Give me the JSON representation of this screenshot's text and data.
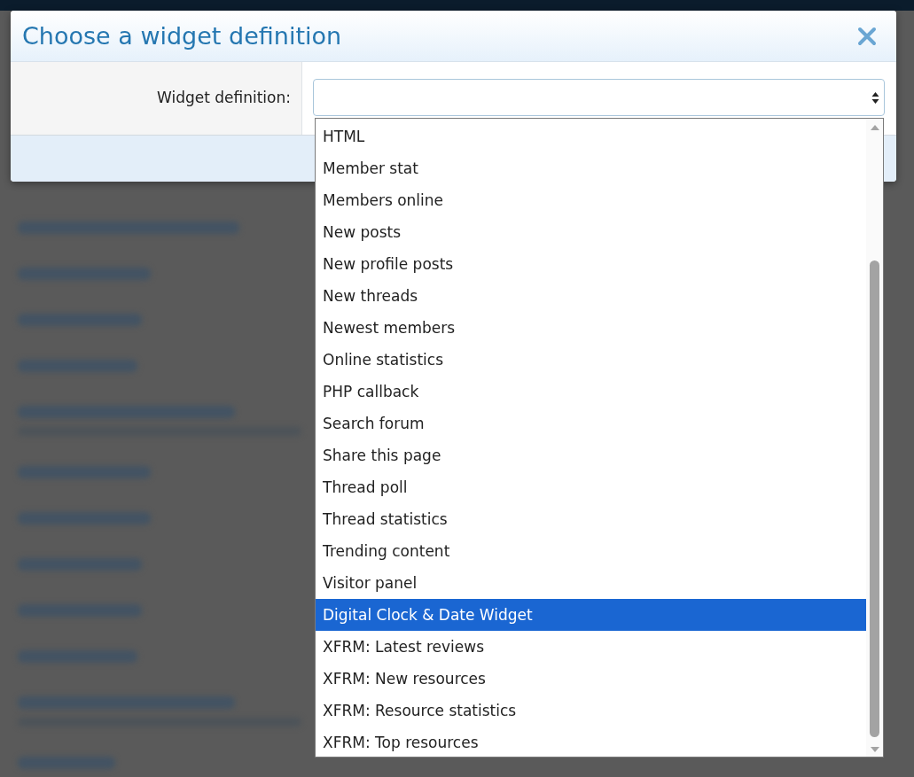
{
  "dialog": {
    "title": "Choose a widget definition",
    "field": {
      "label": "Widget definition:"
    }
  },
  "dropdown": {
    "options": [
      {
        "label": "HTML",
        "selected": false
      },
      {
        "label": "Member stat",
        "selected": false
      },
      {
        "label": "Members online",
        "selected": false
      },
      {
        "label": "New posts",
        "selected": false
      },
      {
        "label": "New profile posts",
        "selected": false
      },
      {
        "label": "New threads",
        "selected": false
      },
      {
        "label": "Newest members",
        "selected": false
      },
      {
        "label": "Online statistics",
        "selected": false
      },
      {
        "label": "PHP callback",
        "selected": false
      },
      {
        "label": "Search forum",
        "selected": false
      },
      {
        "label": "Share this page",
        "selected": false
      },
      {
        "label": "Thread poll",
        "selected": false
      },
      {
        "label": "Thread statistics",
        "selected": false
      },
      {
        "label": "Trending content",
        "selected": false
      },
      {
        "label": "Visitor panel",
        "selected": false
      },
      {
        "label": "Digital Clock & Date Widget",
        "selected": true
      },
      {
        "label": "XFRM: Latest reviews",
        "selected": false
      },
      {
        "label": "XFRM: New resources",
        "selected": false
      },
      {
        "label": "XFRM: Resource statistics",
        "selected": false
      },
      {
        "label": "XFRM: Top resources",
        "selected": false
      }
    ]
  }
}
